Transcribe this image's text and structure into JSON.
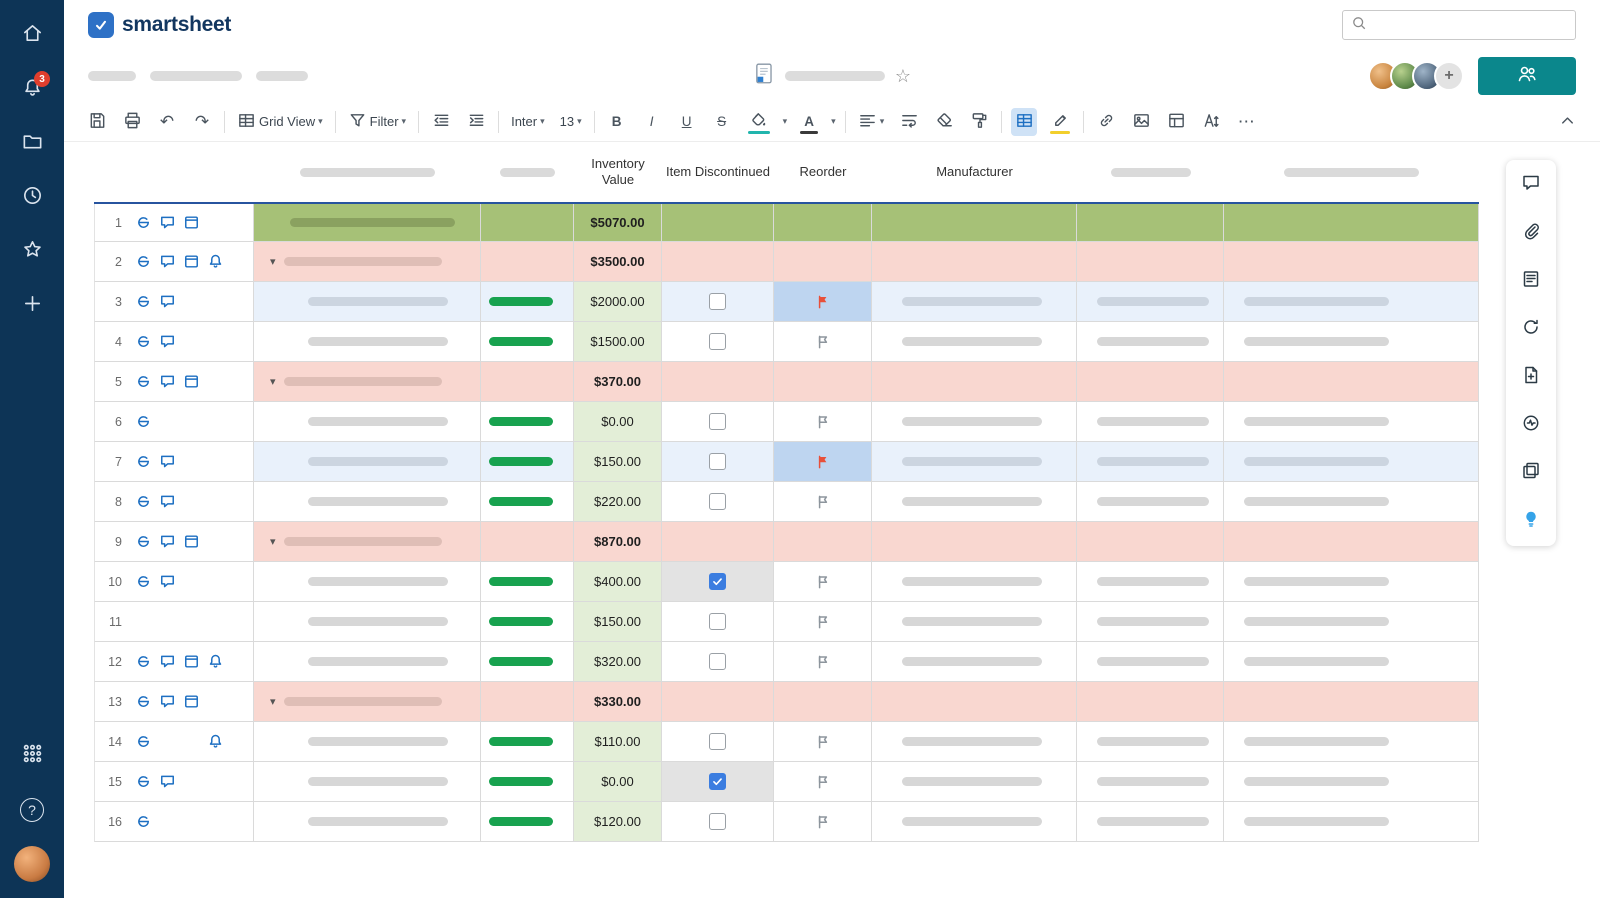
{
  "brand": {
    "logo_text": "smartsheet"
  },
  "topbar": {
    "search_placeholder": ""
  },
  "sidebar": {
    "notification_count": "3",
    "help_label": "?"
  },
  "icons": {
    "undo": "↶",
    "redo": "↷",
    "chevron_down": "▾",
    "collapse_triangle": "▾",
    "more": "⋯",
    "star_outline": "☆"
  },
  "toolbar": {
    "grid_view_label": "Grid View",
    "filter_label": "Filter",
    "font_label": "Inter",
    "font_size_label": "13",
    "bold_label": "B",
    "italic_label": "I",
    "underline_label": "U",
    "strikethrough_label": "S",
    "text_color_label": "A"
  },
  "colors": {
    "sidebar_navy": "#0d3456",
    "share_teal": "#0b878c",
    "parent_row_green": "#a6c177",
    "parent_row_pink": "#f9d7d0",
    "highlight_row_blue": "#e9f1fb",
    "value_column_green": "#e3eed7",
    "progress_bar_green": "#18a24f",
    "checkbox_blue": "#3b7de0",
    "flag_red": "#e8503a",
    "flag_cell_blue": "#bed5f0",
    "row_icon_blue": "#1d6fc2",
    "badge_red": "#e03e2d"
  },
  "grid": {
    "headers": {
      "inventory_value": "Inventory Value",
      "item_discontinued": "Item Discontinued",
      "reorder": "Reorder",
      "manufacturer": "Manufacturer"
    },
    "rows": [
      {
        "num": "1",
        "kind": "green",
        "indent": 0,
        "collapse": false,
        "icons": [
          "attachment",
          "comment",
          "proof"
        ],
        "bar": false,
        "value": "$5070.00",
        "bold": true,
        "checkbox": "none",
        "check_gray": false,
        "flag": "none",
        "flag_blue": false,
        "pills": false
      },
      {
        "num": "2",
        "kind": "pink",
        "indent": 1,
        "collapse": true,
        "icons": [
          "attachment",
          "comment",
          "proof",
          "bell"
        ],
        "bar": false,
        "value": "$3500.00",
        "bold": true,
        "checkbox": "none",
        "check_gray": false,
        "flag": "none",
        "flag_blue": false,
        "pills": false
      },
      {
        "num": "3",
        "kind": "blue",
        "indent": 2,
        "collapse": false,
        "icons": [
          "attachment",
          "comment"
        ],
        "bar": true,
        "value": "$2000.00",
        "bold": false,
        "checkbox": "unchecked",
        "check_gray": false,
        "flag": "red",
        "flag_blue": true,
        "pills": true
      },
      {
        "num": "4",
        "kind": "white",
        "indent": 2,
        "collapse": false,
        "icons": [
          "attachment",
          "comment"
        ],
        "bar": true,
        "value": "$1500.00",
        "bold": false,
        "checkbox": "unchecked",
        "check_gray": false,
        "flag": "gray",
        "flag_blue": false,
        "pills": true
      },
      {
        "num": "5",
        "kind": "pink",
        "indent": 1,
        "collapse": true,
        "icons": [
          "attachment",
          "comment",
          "proof"
        ],
        "bar": false,
        "value": "$370.00",
        "bold": true,
        "checkbox": "none",
        "check_gray": false,
        "flag": "none",
        "flag_blue": false,
        "pills": false
      },
      {
        "num": "6",
        "kind": "white",
        "indent": 2,
        "collapse": false,
        "icons": [
          "attachment"
        ],
        "bar": true,
        "value": "$0.00",
        "bold": false,
        "checkbox": "unchecked",
        "check_gray": false,
        "flag": "gray",
        "flag_blue": false,
        "pills": true
      },
      {
        "num": "7",
        "kind": "blue",
        "indent": 2,
        "collapse": false,
        "icons": [
          "attachment",
          "comment"
        ],
        "bar": true,
        "value": "$150.00",
        "bold": false,
        "checkbox": "unchecked",
        "check_gray": false,
        "flag": "red",
        "flag_blue": true,
        "pills": true
      },
      {
        "num": "8",
        "kind": "white",
        "indent": 2,
        "collapse": false,
        "icons": [
          "attachment",
          "comment"
        ],
        "bar": true,
        "value": "$220.00",
        "bold": false,
        "checkbox": "unchecked",
        "check_gray": false,
        "flag": "gray",
        "flag_blue": false,
        "pills": true
      },
      {
        "num": "9",
        "kind": "pink",
        "indent": 1,
        "collapse": true,
        "icons": [
          "attachment",
          "comment",
          "proof"
        ],
        "bar": false,
        "value": "$870.00",
        "bold": true,
        "checkbox": "none",
        "check_gray": false,
        "flag": "none",
        "flag_blue": false,
        "pills": false
      },
      {
        "num": "10",
        "kind": "white",
        "indent": 2,
        "collapse": false,
        "icons": [
          "attachment",
          "comment"
        ],
        "bar": true,
        "value": "$400.00",
        "bold": false,
        "checkbox": "checked",
        "check_gray": true,
        "flag": "gray",
        "flag_blue": false,
        "pills": true
      },
      {
        "num": "11",
        "kind": "white",
        "indent": 2,
        "collapse": false,
        "icons": [],
        "bar": true,
        "value": "$150.00",
        "bold": false,
        "checkbox": "unchecked",
        "check_gray": false,
        "flag": "gray",
        "flag_blue": false,
        "pills": true
      },
      {
        "num": "12",
        "kind": "white",
        "indent": 2,
        "collapse": false,
        "icons": [
          "attachment",
          "comment",
          "proof",
          "bell"
        ],
        "bar": true,
        "value": "$320.00",
        "bold": false,
        "checkbox": "unchecked",
        "check_gray": false,
        "flag": "gray",
        "flag_blue": false,
        "pills": true
      },
      {
        "num": "13",
        "kind": "pink",
        "indent": 1,
        "collapse": true,
        "icons": [
          "attachment",
          "comment",
          "proof"
        ],
        "bar": false,
        "value": "$330.00",
        "bold": true,
        "checkbox": "none",
        "check_gray": false,
        "flag": "none",
        "flag_blue": false,
        "pills": false
      },
      {
        "num": "14",
        "kind": "white",
        "indent": 2,
        "collapse": false,
        "icons": [
          "attachment",
          "",
          "",
          "bell"
        ],
        "bar": true,
        "value": "$110.00",
        "bold": false,
        "checkbox": "unchecked",
        "check_gray": false,
        "flag": "gray",
        "flag_blue": false,
        "pills": true
      },
      {
        "num": "15",
        "kind": "white",
        "indent": 2,
        "collapse": false,
        "icons": [
          "attachment",
          "comment"
        ],
        "bar": true,
        "value": "$0.00",
        "bold": false,
        "checkbox": "checked",
        "check_gray": true,
        "flag": "gray",
        "flag_blue": false,
        "pills": true
      },
      {
        "num": "16",
        "kind": "white",
        "indent": 2,
        "collapse": false,
        "icons": [
          "attachment"
        ],
        "bar": true,
        "value": "$120.00",
        "bold": false,
        "checkbox": "unchecked",
        "check_gray": false,
        "flag": "gray",
        "flag_blue": false,
        "pills": true
      }
    ]
  }
}
